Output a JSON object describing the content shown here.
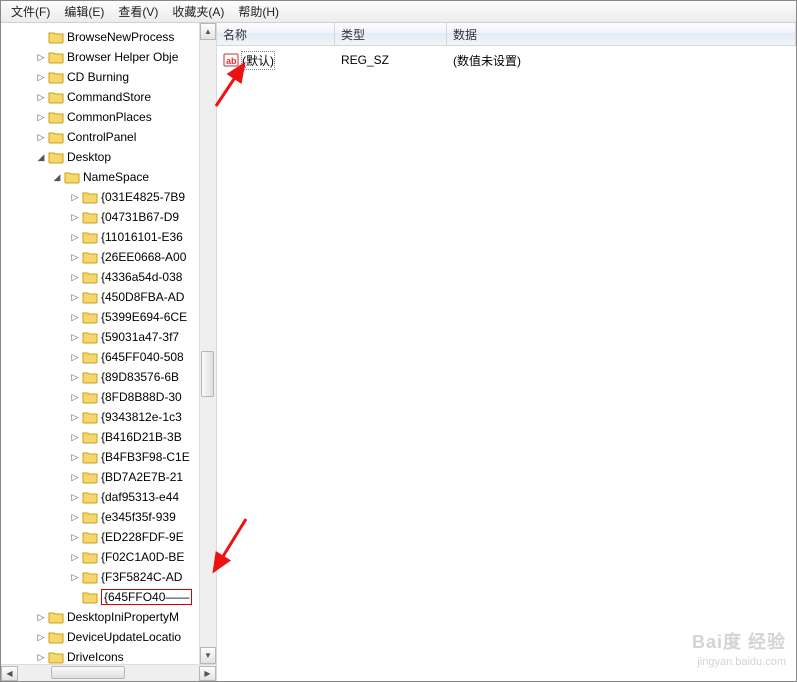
{
  "menu": {
    "file": "文件(F)",
    "edit": "编辑(E)",
    "view": "查看(V)",
    "fav": "收藏夹(A)",
    "help": "帮助(H)"
  },
  "tree": {
    "BrowseNewProcess": "BrowseNewProcess",
    "BrowserHelperObj": "Browser Helper Obje",
    "CDBurning": "CD Burning",
    "CommandStore": "CommandStore",
    "CommonPlaces": "CommonPlaces",
    "ControlPanel": "ControlPanel",
    "Desktop": "Desktop",
    "NameSpace": "NameSpace",
    "ns": {
      "0": "{031E4825-7B9",
      "1": "{04731B67-D9",
      "2": "{11016101-E36",
      "3": "{26EE0668-A00",
      "4": "{4336a54d-038",
      "5": "{450D8FBA-AD",
      "6": "{5399E694-6CE",
      "7": "{59031a47-3f7",
      "8": "{645FF040-508",
      "9": "{89D83576-6B",
      "10": "{8FD8B88D-30",
      "11": "{9343812e-1c3",
      "12": "{B416D21B-3B",
      "13": "{B4FB3F98-C1E",
      "14": "{BD7A2E7B-21",
      "15": "{daf95313-e44",
      "16": "{e345f35f-939",
      "17": "{ED228FDF-9E",
      "18": "{F02C1A0D-BE",
      "19": "{F3F5824C-AD",
      "20": "{645FFO40——"
    },
    "DesktopIniPropertyM": "DesktopIniPropertyM",
    "DeviceUpdateLocatio": "DeviceUpdateLocatio",
    "DriveIcons": "DriveIcons"
  },
  "columns": {
    "name": "名称",
    "type": "类型",
    "data": "数据"
  },
  "values": {
    "default": {
      "name": "(默认)",
      "type": "REG_SZ",
      "data": "(数值未设置)"
    }
  },
  "watermark": {
    "brand": "Bai度 经验",
    "url": "jingyan.baidu.com"
  }
}
